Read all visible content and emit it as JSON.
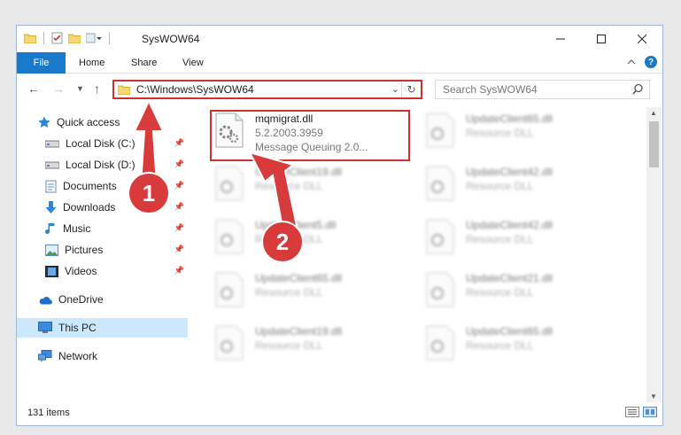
{
  "window": {
    "title": "SysWOW64"
  },
  "ribbon": {
    "tabs": [
      "File",
      "Home",
      "Share",
      "View"
    ],
    "help": "?"
  },
  "address": {
    "path": "C:\\Windows\\SysWOW64"
  },
  "search": {
    "placeholder": "Search SysWOW64"
  },
  "sidebar": {
    "items": [
      {
        "label": "Quick access",
        "icon": "star-icon"
      },
      {
        "label": "Local Disk (C:)",
        "icon": "drive-icon",
        "pinned": true
      },
      {
        "label": "Local Disk (D:)",
        "icon": "drive-icon",
        "pinned": true
      },
      {
        "label": "Documents",
        "icon": "documents-icon",
        "pinned": true
      },
      {
        "label": "Downloads",
        "icon": "download-icon",
        "pinned": true
      },
      {
        "label": "Music",
        "icon": "music-icon",
        "pinned": true
      },
      {
        "label": "Pictures",
        "icon": "pictures-icon",
        "pinned": true
      },
      {
        "label": "Videos",
        "icon": "videos-icon",
        "pinned": true
      },
      {
        "label": "OneDrive",
        "icon": "cloud-icon"
      },
      {
        "label": "This PC",
        "icon": "computer-icon",
        "selected": true
      },
      {
        "label": "Network",
        "icon": "network-icon"
      }
    ]
  },
  "files": {
    "highlighted": {
      "name": "mqmigrat.dll",
      "version": "5.2.2003.3959",
      "description": "Message Queuing 2.0..."
    },
    "blurred_right": [
      {
        "name": "UpdateClient65.dll",
        "type": "Resource DLL"
      },
      {
        "name": "UpdateClient42.dll",
        "type": "Resource DLL"
      },
      {
        "name": "UpdateClient42.dll",
        "type": "Resource DLL"
      },
      {
        "name": "UpdateClient21.dll",
        "type": "Resource DLL"
      },
      {
        "name": "UpdateClient65.dll",
        "type": "Resource DLL"
      }
    ],
    "blurred_left": [
      {
        "name": "UpdateClient19.dll",
        "type": "Resource DLL"
      },
      {
        "name": "UpdateClient5.dll",
        "type": "Resource DLL"
      },
      {
        "name": "UpdateClient65.dll",
        "type": "Resource DLL"
      },
      {
        "name": "UpdateClient19.dll",
        "type": "Resource DLL"
      }
    ]
  },
  "status": {
    "count": "131 items"
  },
  "annotations": {
    "callout1": "1",
    "callout2": "2",
    "color": "#d83b3b"
  }
}
